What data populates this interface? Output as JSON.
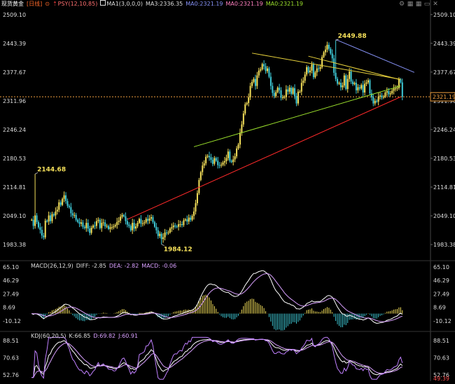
{
  "header": {
    "instrument": "现货黄金",
    "period": "[日线]",
    "psy": "PSY(12,10,85)",
    "ma1": "MA1(3,0,0,0)",
    "ma3": "MA3:2336.35",
    "ma_a": "MA0:2321.19",
    "ma_b": "MA0:2321.19",
    "ma_c": "MA0:2321.19"
  },
  "toolbar_icons": [
    "settings-icon",
    "grid-icon",
    "grid-icon",
    "minus-icon",
    "close-icon"
  ],
  "colors": {
    "up": "#f5e05a",
    "down": "#3fcbd8",
    "support": "#ff2a2a",
    "trend_green": "#9be02c",
    "trend_yellow": "#e8d23c",
    "trend_blue": "#8591f5",
    "current_price": "#f0a040",
    "macd_dif": "#ffffff",
    "macd_dea": "#d9a0ff",
    "psy": "#ff4040",
    "ma": "#8591f5",
    "ma0": "#9be02c"
  },
  "chart_data": [
    {
      "type": "candlestick",
      "title": "现货黄金 [日线]",
      "ylim": [
        1953,
        2520
      ],
      "y_ticks": [
        "2509.10",
        "2443.39",
        "2377.67",
        "2311.96",
        "2246.24",
        "2180.53",
        "2114.81",
        "2049.10",
        "1983.38"
      ],
      "current_price": "2321.19",
      "current_price_value": 2321.19,
      "annotations": [
        {
          "label": "2449.88",
          "value": 2449.88,
          "bar": 178
        },
        {
          "label": "2144.68",
          "value": 2144.68,
          "bar": 2
        },
        {
          "label": "1984.12",
          "value": 1984.12,
          "bar": 76
        }
      ],
      "trendlines": [
        {
          "name": "support",
          "from": [
            56,
            2041
          ],
          "to": [
            216,
            2321
          ],
          "color": "support"
        },
        {
          "name": "lower-wedge",
          "from": [
            95,
            2207
          ],
          "to": [
            216,
            2346
          ],
          "color": "trend_green"
        },
        {
          "name": "upper-wedge",
          "from": [
            129,
            2421
          ],
          "to": [
            216,
            2361
          ],
          "color": "trend_yellow"
        },
        {
          "name": "upper-wedge-2",
          "from": [
            162,
            2414
          ],
          "to": [
            216,
            2360
          ],
          "color": "trend_yellow"
        },
        {
          "name": "channel-top",
          "from": [
            178,
            2452
          ],
          "to": [
            224,
            2377
          ],
          "color": "trend_blue"
        }
      ],
      "closes": [
        2040,
        2026,
        2050,
        2035,
        2023,
        2017,
        2004,
        2000,
        2038,
        2036,
        2050,
        2037,
        2053,
        2050,
        2059,
        2063,
        2080,
        2074,
        2088,
        2096,
        2083,
        2072,
        2069,
        2055,
        2050,
        2051,
        2040,
        2035,
        2031,
        2034,
        2024,
        2021,
        2033,
        2020,
        2010,
        2022,
        2027,
        2026,
        2037,
        2040,
        2021,
        2033,
        2034,
        2025,
        2026,
        2019,
        2023,
        2023,
        2025,
        2028,
        2035,
        2038,
        2047,
        2051,
        2048,
        2037,
        2029,
        2026,
        2016,
        2033,
        2020,
        2025,
        2033,
        2042,
        2031,
        2032,
        2034,
        2042,
        2038,
        2043,
        2046,
        2035,
        2024,
        2016,
        2003,
        2008,
        1996,
        2000,
        2011,
        2010,
        2011,
        2020,
        2023,
        2027,
        2025,
        2024,
        2030,
        2030,
        2028,
        2039,
        2041,
        2036,
        2045,
        2040,
        2049,
        2059,
        2078,
        2101,
        2131,
        2149,
        2164,
        2169,
        2184,
        2186,
        2183,
        2177,
        2168,
        2181,
        2175,
        2165,
        2164,
        2166,
        2171,
        2174,
        2181,
        2196,
        2175,
        2172,
        2178,
        2185,
        2203,
        2212,
        2239,
        2258,
        2283,
        2304,
        2307,
        2320,
        2346,
        2355,
        2362,
        2346,
        2370,
        2381,
        2384,
        2396,
        2391,
        2380,
        2386,
        2367,
        2346,
        2330,
        2323,
        2332,
        2342,
        2336,
        2319,
        2320,
        2321,
        2338,
        2333,
        2342,
        2328,
        2341,
        2323,
        2306,
        2333,
        2333,
        2353,
        2358,
        2372,
        2389,
        2377,
        2381,
        2395,
        2366,
        2377,
        2386,
        2385,
        2389,
        2412,
        2423,
        2429,
        2440,
        2431,
        2420,
        2409,
        2376,
        2362,
        2351,
        2353,
        2343,
        2347,
        2370,
        2339,
        2362,
        2379,
        2356,
        2350,
        2353,
        2336,
        2343,
        2340,
        2348,
        2331,
        2351,
        2354,
        2359,
        2329,
        2320,
        2306,
        2312,
        2310,
        2322,
        2324,
        2320,
        2321,
        2331,
        2334,
        2327,
        2329,
        2335,
        2340,
        2340,
        2341,
        2361,
        2354,
        2321
      ]
    },
    {
      "type": "macd",
      "title": "MACD(26,12,9)",
      "values": {
        "DIFF": -2.85,
        "DEA": -2.82,
        "MACD": -0.06
      },
      "legend": [
        "MACD(26,12,9)",
        "DIFF: -2.85",
        "DEA: -2.82",
        "MACD: -0.06"
      ],
      "ylim": [
        -20,
        66
      ],
      "y_ticks": [
        "65.10",
        "46.29",
        "27.49",
        "8.69",
        "-10.12"
      ]
    },
    {
      "type": "kdj",
      "title": "KDJ(60,20,5)",
      "values": {
        "K": 66.85,
        "D": 69.82,
        "J": 60.91
      },
      "legend": [
        "KDJ(60,20,5)",
        "K:66.85",
        "D:69.82",
        "J:60.91"
      ],
      "ylim": [
        46,
        93
      ],
      "y_ticks": [
        "88.51",
        "70.63",
        "52.76"
      ],
      "current_label": "49.39"
    }
  ]
}
